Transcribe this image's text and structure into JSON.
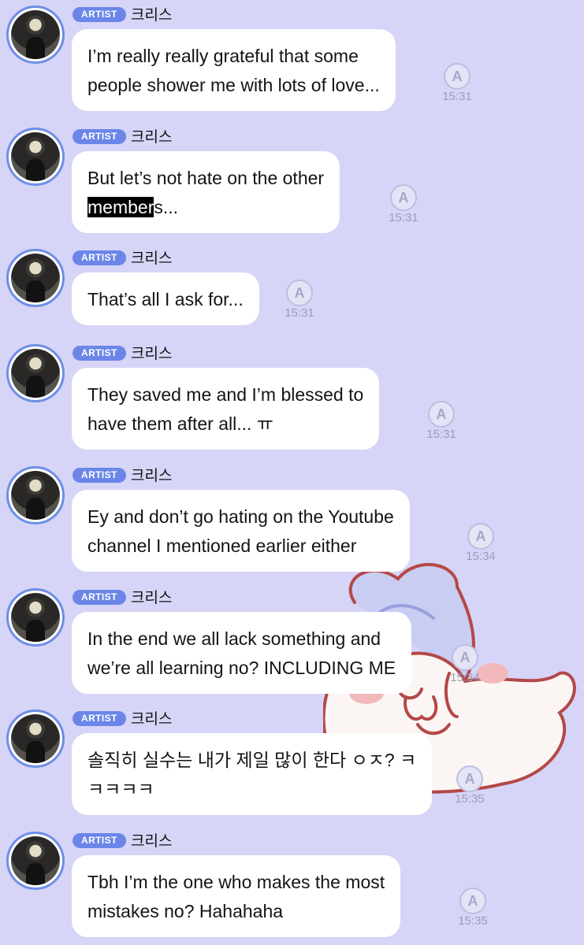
{
  "sender": {
    "badge": "ARTIST",
    "name": "크리스"
  },
  "messages": [
    {
      "lines": [
        "I’m really really grateful that some",
        "people shower me with lots of love..."
      ],
      "time": "15:31"
    },
    {
      "lines": [
        "But let’s not hate on the other",
        "members..."
      ],
      "time": "15:31",
      "highlight": "member"
    },
    {
      "lines": [
        "That’s all I ask for..."
      ],
      "time": "15:31"
    },
    {
      "lines": [
        "They saved me and I’m blessed to",
        "have them after all... ㅠ"
      ],
      "time": "15:31"
    },
    {
      "lines": [
        "Ey and don’t go hating on the Youtube",
        "channel I mentioned earlier either"
      ],
      "time": "15:34"
    },
    {
      "lines": [
        "In the end we all lack something and",
        "we’re all learning no? INCLUDING ME"
      ],
      "time": "15:34"
    },
    {
      "lines": [
        "솔직히 실수는 내가 제일 많이 한다 ㅇㅈ? ㅋ",
        "ㅋㅋㅋㅋ"
      ],
      "time": "15:35"
    },
    {
      "lines": [
        "Tbh I’m the one who makes the most",
        "mistakes no? Hahahaha"
      ],
      "time": "15:35"
    }
  ],
  "icons": {
    "translate": "translate-icon",
    "avatar": "avatar"
  },
  "colors": {
    "background": "#d6d5f7",
    "badge": "#6b86e8",
    "bubble": "#ffffff",
    "avatar_ring": "#6d8fe6"
  }
}
